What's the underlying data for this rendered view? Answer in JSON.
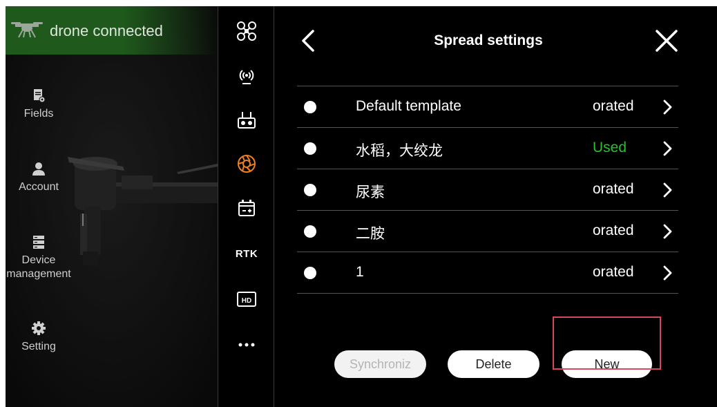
{
  "status_bar": {
    "text": "drone connected",
    "icon": "drone-icon",
    "color": "#1f5a1c"
  },
  "nav": {
    "fields": {
      "label": "Fields",
      "icon": "document-gear-icon"
    },
    "account": {
      "label": "Account",
      "icon": "person-icon"
    },
    "device": {
      "label_line1": "Device",
      "label_line2": "management",
      "icon": "server-icon"
    },
    "setting": {
      "label": "Setting",
      "icon": "gear-icon"
    }
  },
  "icon_bar": {
    "items": [
      {
        "name": "drone-icon"
      },
      {
        "name": "signal-icon"
      },
      {
        "name": "remote-controller-icon"
      },
      {
        "name": "spray-nozzle-icon",
        "color": "#f0821e"
      },
      {
        "name": "battery-icon"
      },
      {
        "name": "rtk-icon",
        "label": "RTK"
      },
      {
        "name": "hd-icon",
        "label": "HD"
      },
      {
        "name": "more-icon"
      }
    ]
  },
  "settings": {
    "title": "Spread settings",
    "templates": [
      {
        "name": "Default template",
        "status": "orated",
        "status_color": "#ffffff"
      },
      {
        "name": "水稻，大绞龙",
        "status": "Used",
        "status_color": "#22c42a"
      },
      {
        "name": "尿素",
        "status": "orated",
        "status_color": "#ffffff"
      },
      {
        "name": "二胺",
        "status": "orated",
        "status_color": "#ffffff"
      },
      {
        "name": "1",
        "status": "orated",
        "status_color": "#ffffff"
      }
    ],
    "buttons": {
      "synchronize": "Synchroniz",
      "delete": "Delete",
      "new": "New"
    }
  },
  "colors": {
    "used": "#22c42a",
    "highlight": "#d9475c",
    "accent_orange": "#f0821e"
  }
}
